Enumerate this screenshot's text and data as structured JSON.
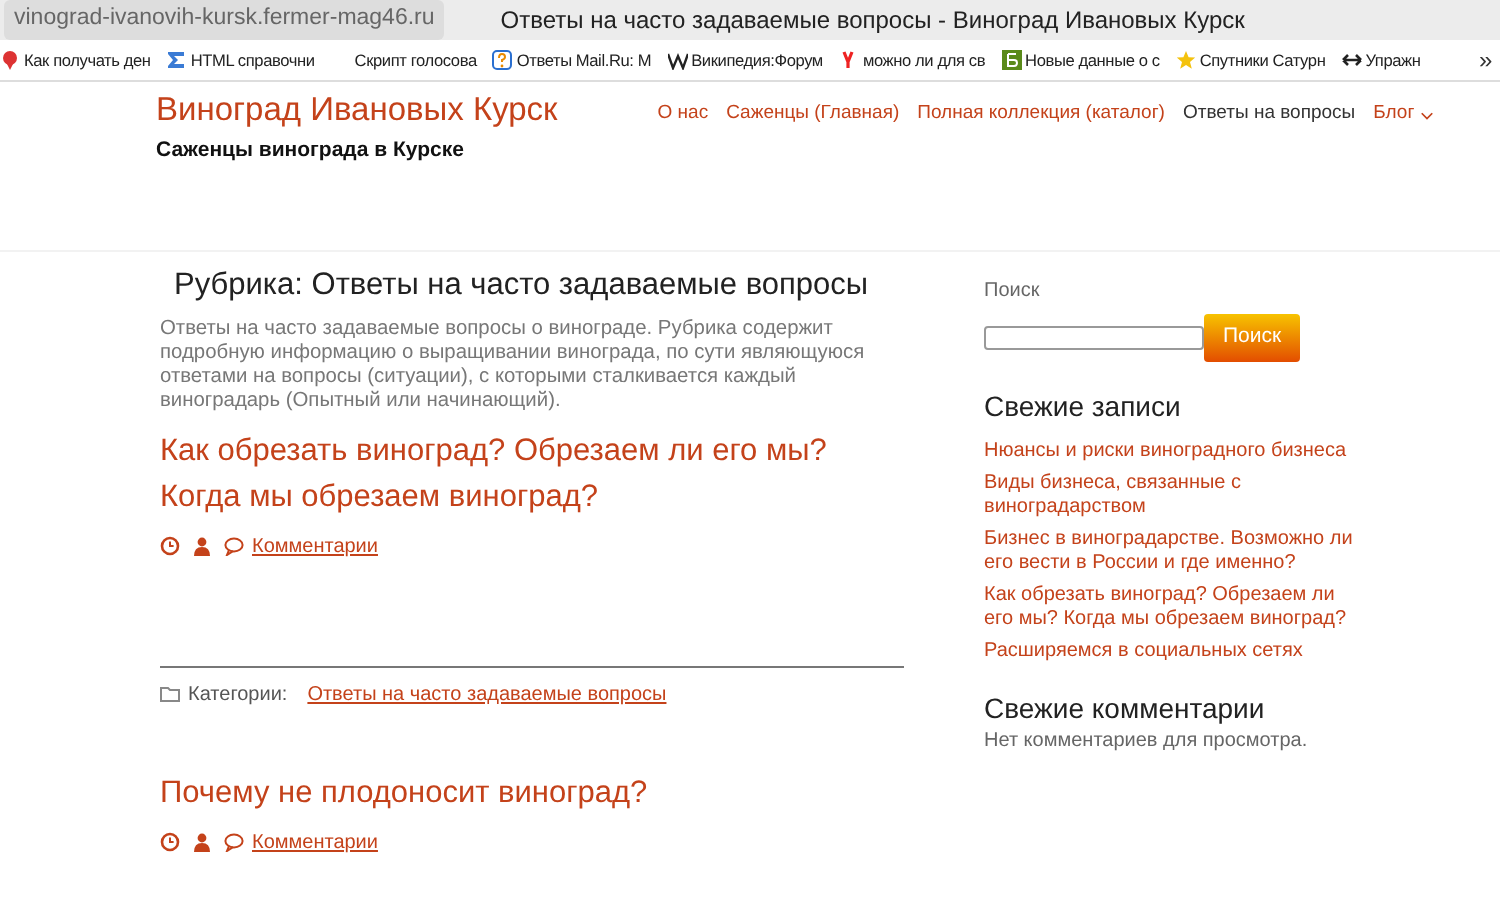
{
  "browser": {
    "address": "vinograd-ivanovih-kursk.fermer-mag46.ru",
    "title": "Ответы на часто задаваемые вопросы - Виноград Ивановых Курск"
  },
  "bookmarks": [
    {
      "kind": "pin",
      "label": "Как получать ден"
    },
    {
      "kind": "html",
      "label": "HTML справочни"
    },
    {
      "kind": "none",
      "label": "Скрипт голосова"
    },
    {
      "kind": "question",
      "label": "Ответы Mail.Ru: M"
    },
    {
      "kind": "wiki",
      "label": "Википедия:Форум"
    },
    {
      "kind": "yandex",
      "label": "можно ли для св"
    },
    {
      "kind": "b",
      "label": "Новые данные о с"
    },
    {
      "kind": "star",
      "label": "Спутники Сатурн"
    },
    {
      "kind": "arrows",
      "label": "Упражн"
    }
  ],
  "bookmarks_more": "»",
  "site": {
    "title": "Виноград Ивановых Курск",
    "tagline": "Саженцы винограда в Курске"
  },
  "menu": [
    {
      "label": "О нас",
      "selected": false,
      "dropdown": false
    },
    {
      "label": "Саженцы (Главная)",
      "selected": false,
      "dropdown": false
    },
    {
      "label": "Полная коллекция (каталог)",
      "selected": false,
      "dropdown": false
    },
    {
      "label": "Ответы на вопросы",
      "selected": true,
      "dropdown": false
    },
    {
      "label": "Блог",
      "selected": false,
      "dropdown": true
    }
  ],
  "archive": {
    "heading": "Рубрика: Ответы на часто задаваемые вопросы",
    "description": "Ответы на часто задаваемые вопросы о винограде. Рубрика содержит подробную информацию о выращивании винограда, по сути являющуюся ответами на вопросы (ситуации), с которыми сталкивается каждый виноградарь (Опытный или начинающий)."
  },
  "posts": [
    {
      "title": "Как обрезать виноград? Обрезаем ли его мы? Когда мы обрезаем виноград?",
      "comments": "Комментарии",
      "categories_label": "Категории:",
      "category": "Ответы на часто задаваемые вопросы"
    },
    {
      "title": "Почему не плодоносит виноград?",
      "comments": "Комментарии"
    }
  ],
  "sidebar": {
    "search_label": "Поиск",
    "search_button": "Поиск",
    "recent_heading": "Свежие записи",
    "recent": [
      "Нюансы и риски виноградного бизнеса",
      "Виды бизнеса, связанные с виноградарством",
      "Бизнес в виноградарстве. Возможно ли его вести в России и где именно?",
      "Как обрезать виноград? Обрезаем ли его мы? Когда мы обрезаем виноград?",
      "Расширяемся в социальных сетях"
    ],
    "comments_heading": "Свежие комментарии",
    "comments_empty": "Нет комментариев для просмотра."
  }
}
